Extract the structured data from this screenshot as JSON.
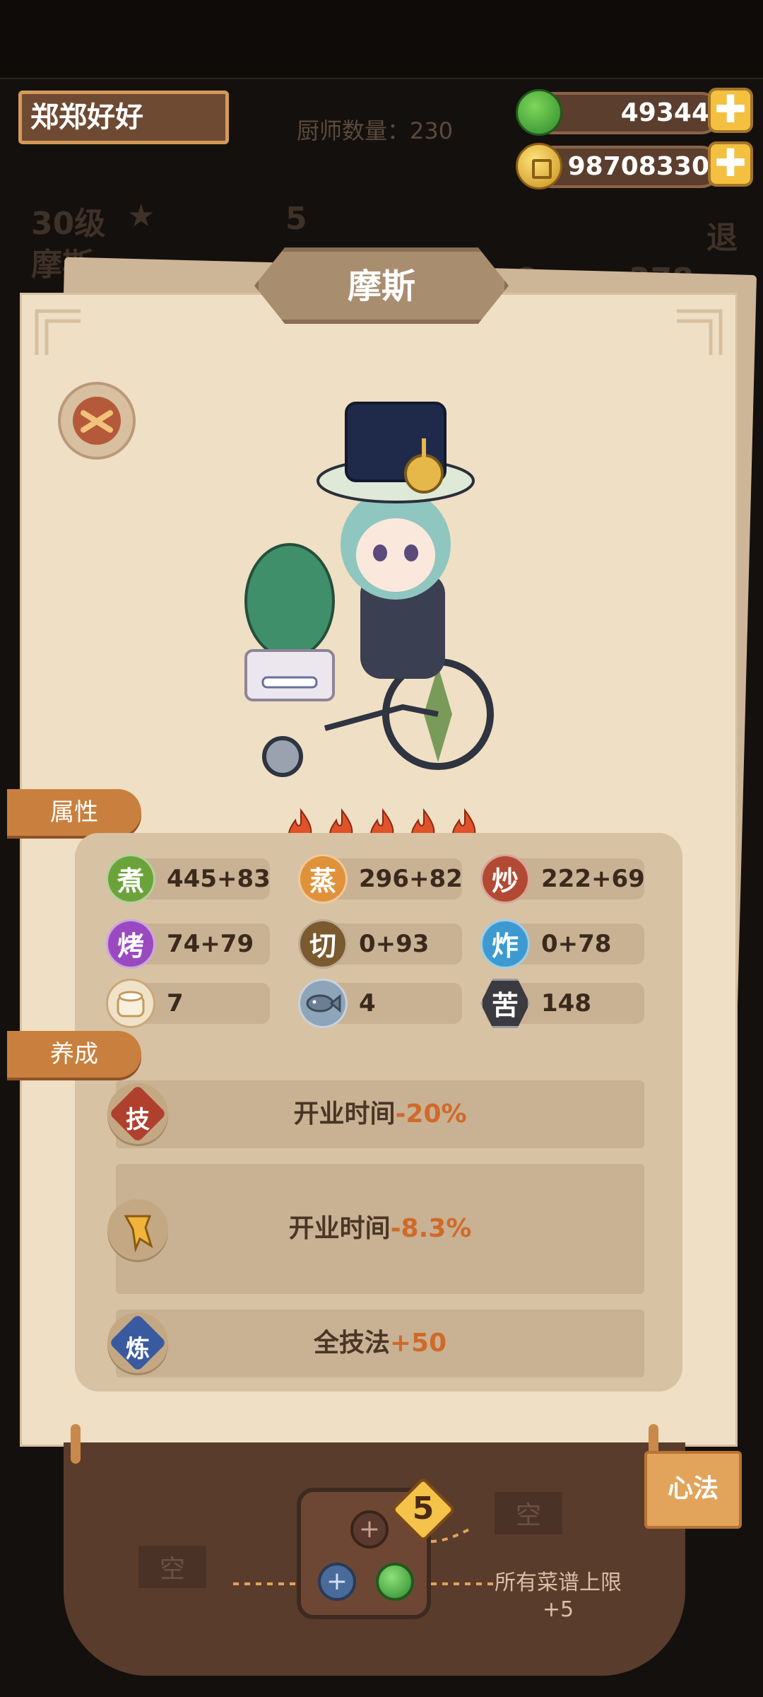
{
  "header": {
    "player_name": "郑郑好好",
    "chef_count_label": "厨师数量：230",
    "jade_amount": "49344",
    "coin_amount": "98708330",
    "plus": "✚"
  },
  "background": {
    "level": "30级",
    "chef_name_bg": "摩斯",
    "badge_num": "5",
    "num_a": "8",
    "num_b": "378",
    "btn_bg": "退"
  },
  "chef": {
    "name": "摩斯",
    "stars": 5
  },
  "sections": {
    "attributes": "属性",
    "training": "养成"
  },
  "stats": [
    {
      "icon": "煮",
      "value": "445+83",
      "color": "#6ba33a"
    },
    {
      "icon": "蒸",
      "value": "296+82",
      "color": "#e0923a"
    },
    {
      "icon": "炒",
      "value": "222+69",
      "color": "#b24a33"
    },
    {
      "icon": "烤",
      "value": "74+79",
      "color": "#9a4ac0"
    },
    {
      "icon": "切",
      "value": "0+93",
      "color": "#7a5a2e"
    },
    {
      "icon": "炸",
      "value": "0+78",
      "color": "#3c9ad0"
    },
    {
      "icon": "",
      "value": "7",
      "color": "#efe2c8"
    },
    {
      "icon": "",
      "value": "4",
      "color": "#8ea4b8"
    },
    {
      "icon": "苦",
      "value": "148",
      "color": "#3a3a40"
    }
  ],
  "training": [
    {
      "icon": "技",
      "text": "开业时间",
      "bonus": "-20%"
    },
    {
      "icon": "",
      "text": "开业时间",
      "bonus": "-8.3%"
    },
    {
      "icon": "炼",
      "text": "全技法",
      "bonus": "+50"
    }
  ],
  "bottom": {
    "xinfa_button": "心法",
    "slot_level": "5",
    "empty_left": "空",
    "empty_right": "空",
    "bonus_desc": "所有菜谱上限+5"
  }
}
